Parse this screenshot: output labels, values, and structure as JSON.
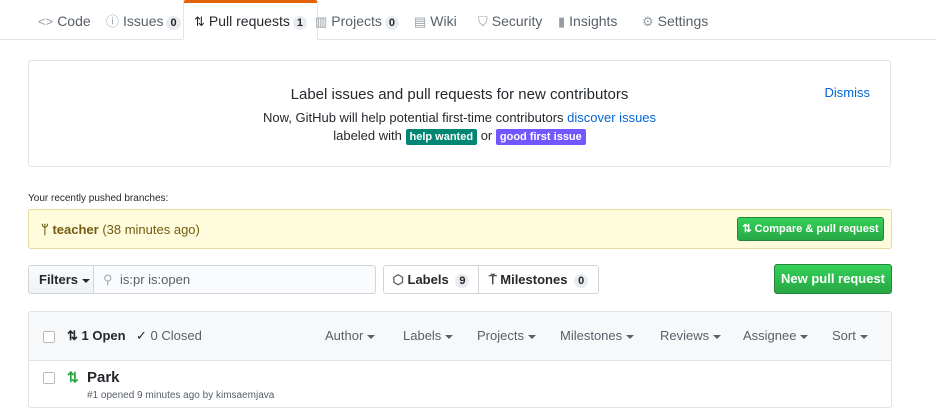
{
  "tabs": [
    {
      "icon": "<>",
      "label": "Code",
      "count": null
    },
    {
      "icon": "ⓘ",
      "label": "Issues",
      "count": "0"
    },
    {
      "icon": "⇅",
      "label": "Pull requests",
      "count": "1"
    },
    {
      "icon": "▥",
      "label": "Projects",
      "count": "0"
    },
    {
      "icon": "▤",
      "label": "Wiki",
      "count": null
    },
    {
      "icon": "⛉",
      "label": "Security",
      "count": null
    },
    {
      "icon": "▮",
      "label": "Insights",
      "count": null
    },
    {
      "icon": "⚙",
      "label": "Settings",
      "count": null
    }
  ],
  "banner": {
    "title": "Label issues and pull requests for new contributors",
    "line1_text": "Now, GitHub will help potential first-time contributors",
    "line1_link": "discover issues",
    "line2_prefix": "labeled with",
    "label_help": "help wanted",
    "line2_or": "or",
    "label_first": "good first issue",
    "dismiss": "Dismiss",
    "colors": {
      "help": "#008672",
      "first": "#7057ff"
    }
  },
  "recent": {
    "heading": "Your recently pushed branches:",
    "branch": "teacher",
    "time": "(38 minutes ago)",
    "compare_button": "Compare & pull request"
  },
  "filterbar": {
    "filters_label": "Filters",
    "search_value": "is:pr is:open",
    "labels_label": "Labels",
    "labels_count": "9",
    "milestones_label": "Milestones",
    "milestones_count": "0",
    "new_pr_button": "New pull request"
  },
  "list": {
    "open_label": "1 Open",
    "closed_label": "0 Closed",
    "filters": [
      "Author",
      "Labels",
      "Projects",
      "Milestones",
      "Reviews",
      "Assignee",
      "Sort"
    ],
    "items": [
      {
        "title": "Park",
        "meta": "#1 opened 9 minutes ago by kimsaemjava"
      }
    ]
  }
}
